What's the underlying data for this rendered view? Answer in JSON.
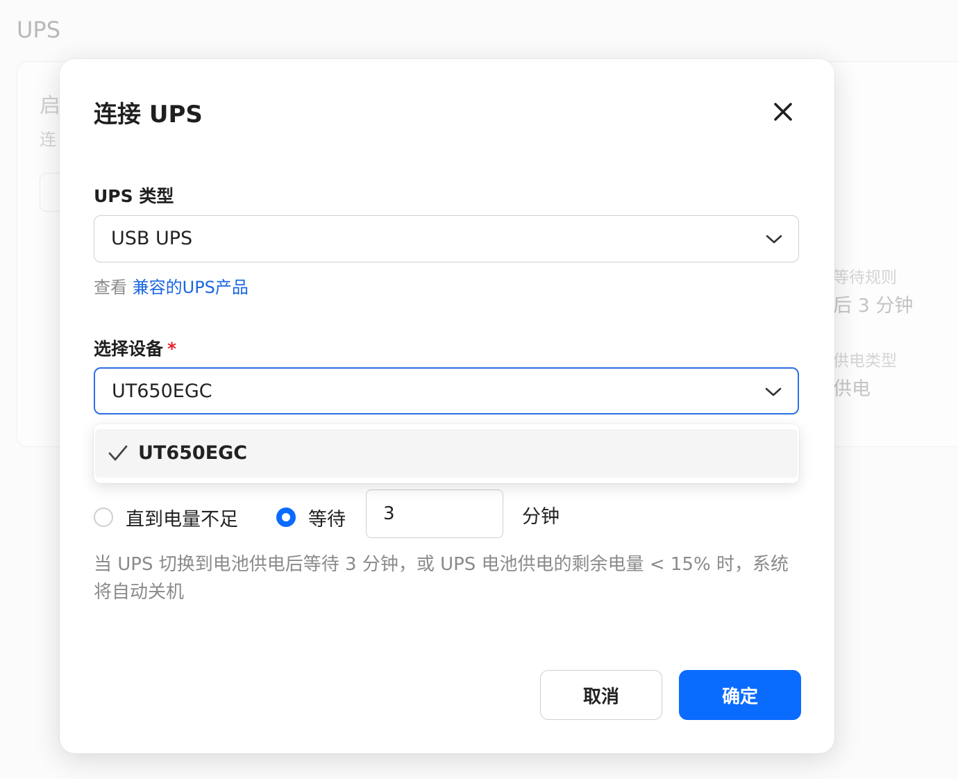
{
  "background": {
    "page_title": "UPS",
    "card_title_fragment": "启",
    "card_sub_fragment": "连",
    "button_fragment": "",
    "right_info": [
      {
        "label": "等待规则",
        "value": "后 3 分钟"
      },
      {
        "label": "供电类型",
        "value": "供电"
      }
    ]
  },
  "modal": {
    "title": "连接 UPS",
    "close_icon": "close-icon",
    "ups_type": {
      "label": "UPS 类型",
      "value": "USB UPS"
    },
    "helper": {
      "prefix": "查看 ",
      "link": "兼容的UPS产品"
    },
    "device": {
      "label": "选择设备",
      "required_mark": "*",
      "value": "UT650EGC",
      "options": [
        {
          "label": "UT650EGC",
          "selected": true
        }
      ]
    },
    "shutdown_rule": {
      "options": [
        {
          "label": "直到电量不足",
          "checked": false
        },
        {
          "label": "等待",
          "checked": true
        }
      ],
      "minutes": "3",
      "unit": "分钟"
    },
    "description": "当 UPS 切换到电池供电后等待 3 分钟，或 UPS 电池供电的剩余电量 < 15% 时，系统将自动关机",
    "buttons": {
      "cancel": "取消",
      "confirm": "确定"
    }
  },
  "colors": {
    "accent": "#0a6bff",
    "link": "#1a66e0",
    "required": "#e5242e",
    "focus_border": "#2b6fe5"
  }
}
